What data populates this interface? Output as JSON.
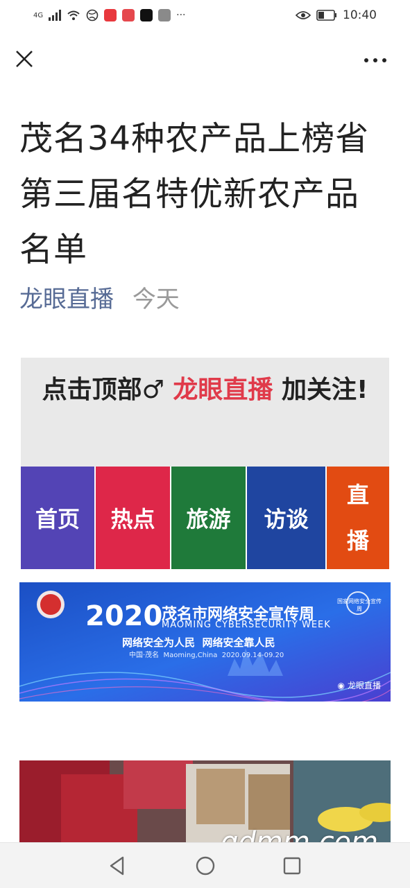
{
  "status_bar": {
    "network": "4G",
    "time": "10:40"
  },
  "article": {
    "title": "茂名34种农产品上榜省第三届名特优新农产品名单",
    "author": "龙眼直播",
    "date": "今天"
  },
  "follow_box": {
    "prefix": "点击顶部♂",
    "highlight": "龙眼直播",
    "suffix": "加关注!"
  },
  "tiles": [
    {
      "label": "首页",
      "color": "#5344b5"
    },
    {
      "label": "热点",
      "color": "#de2749"
    },
    {
      "label": "旅游",
      "color": "#1f7a3a"
    },
    {
      "label": "访谈",
      "color": "#1f45a0"
    },
    {
      "label_line1": "直",
      "label_line2": "播",
      "color": "#e24b12"
    }
  ],
  "banner": {
    "year": "2020",
    "title_cn": "茂名市网络安全宣传周",
    "title_en": "MAOMING CYBERSECURITY WEEK",
    "slogan": "网络安全为人民  网络安全靠人民",
    "place_date": "中国·茂名  Maoming,China  2020.09.14-09.20",
    "badge": "国家网络安全宣传周",
    "account": "龙眼直播"
  },
  "watermark": "gdmm.com",
  "colors": {
    "accent": "#e03a4a",
    "link": "#576b95"
  }
}
